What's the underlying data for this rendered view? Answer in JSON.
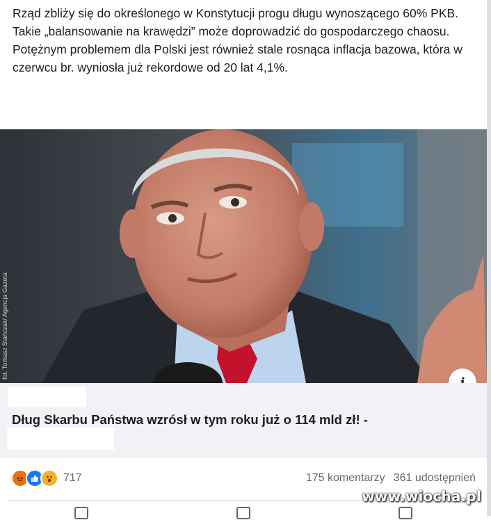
{
  "post": {
    "body_text": "Rząd zbliży się do określonego w Konstytucji progu długu wynoszącego 60% PKB. Takie „balansowanie na krawędzi” może doprowadzić do gospodarczego chaosu. Potężnym problemem dla Polski jest również stale rosnąca inflacja bazowa, która w czerwcu br. wyniosła już rekordowe od 20 lat 4,1%."
  },
  "link_preview": {
    "image_credit": "fot. Tomasz Stańczak/ Agencja Gazeta",
    "info_icon": "i",
    "headline": "Dług Skarbu Państwa wzrósł w tym roku już o 114 mld zł! -"
  },
  "engagement": {
    "reaction_icons": [
      "angry-icon",
      "like-icon",
      "wow-icon"
    ],
    "reaction_count": "717",
    "comments": "175 komentarzy",
    "shares": "361 udostępnień"
  },
  "colors": {
    "like_blue": "#1877f2",
    "angry_orange": "#e9710f",
    "wow_yellow": "#f7b125",
    "secondary_text": "#65676b",
    "link_bg": "#f0f2f5"
  },
  "watermark": "www.wiocha.pl"
}
